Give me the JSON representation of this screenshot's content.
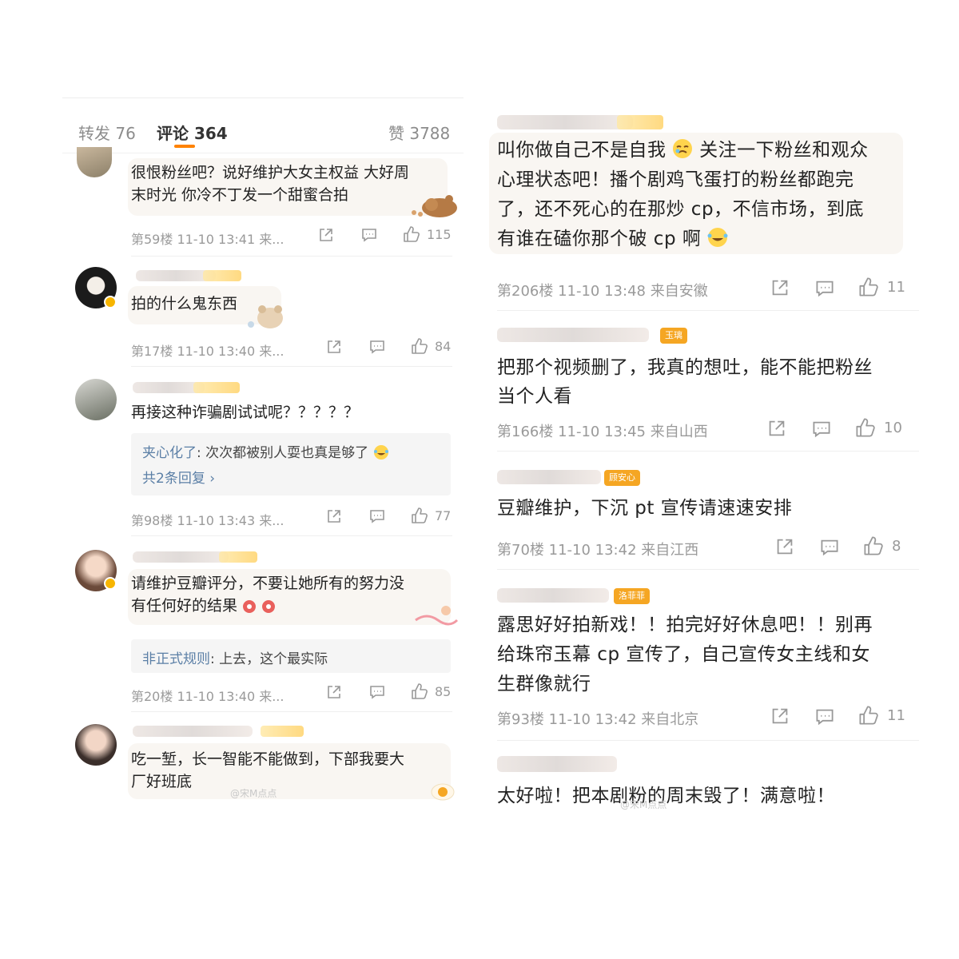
{
  "left": {
    "tabs": [
      {
        "label": "转发",
        "count": "76"
      },
      {
        "label": "评论",
        "count": "364"
      },
      {
        "label": "赞",
        "count": "3788"
      }
    ],
    "comments": [
      {
        "line1": "很恨粉丝吧？说好维护大女主权益 大好周",
        "line2": "末时光 你冷不丁发一个甜蜜合拍",
        "meta": "第59楼 11-10 13:41 来...",
        "likes": "115"
      },
      {
        "line1": "拍的什么鬼东西",
        "meta": "第17楼 11-10 13:40 来...",
        "likes": "84"
      },
      {
        "line1": "再接这种诈骗剧试试呢？？？？？",
        "reply_name": "夹心化了",
        "reply_text": ": 次次都被别人耍也真是够了",
        "reply_more": "共2条回复 ›",
        "meta": "第98楼 11-10 13:43 来...",
        "likes": "77"
      },
      {
        "line1": "请维护豆瓣评分，不要让她所有的努力没",
        "line2": "有任何好的结果",
        "reply_name": "非正式规则",
        "reply_text": ": 上去，这个最实际",
        "meta": "第20楼 11-10 13:40 来...",
        "likes": "85"
      },
      {
        "line1": "吃一堑，长一智能不能做到，下部我要大",
        "line2": "厂好班底"
      }
    ],
    "watermark": "@宋M点点"
  },
  "right": {
    "comments": [
      {
        "line1": "叫你做自己不是自我",
        "line1b": "关注一下粉丝和观众",
        "line2": "心理状态吧！播个剧鸡飞蛋打的粉丝都跑完",
        "line3": "了，还不死心的在那炒 cp，不信市场，到底",
        "line4": "有谁在磕你那个破 cp 啊",
        "meta": "第206楼 11-10 13:48 来自安徽",
        "likes": "11"
      },
      {
        "badge": "玉璃",
        "line1": "把那个视频删了，我真的想吐，能不能把粉丝",
        "line2": "当个人看",
        "meta": "第166楼 11-10 13:45 来自山西",
        "likes": "10"
      },
      {
        "badge": "顾安心",
        "line1": "豆瓣维护，下沉 pt 宣传请速速安排",
        "meta": "第70楼 11-10 13:42 来自江西",
        "likes": "8"
      },
      {
        "badge": "洛菲菲",
        "line1": "露思好好拍新戏！！拍完好好休息吧！！别再",
        "line2": "给珠帘玉幕 cp 宣传了，自己宣传女主线和女",
        "line3": "生群像就行",
        "meta": "第93楼 11-10 13:42 来自北京",
        "likes": "11"
      },
      {
        "line1": "太好啦！把本剧粉的周末毁了！满意啦！"
      }
    ],
    "watermark": "@宋M点点"
  },
  "colors": {
    "accent": "#ff8200",
    "reply_name": "#5b7fa6",
    "meta": "#9a9a9a",
    "bubble": "#f9f6f2"
  },
  "icons": [
    "share-icon",
    "comment-icon",
    "like-icon",
    "verified-icon",
    "chevron-right-icon"
  ]
}
